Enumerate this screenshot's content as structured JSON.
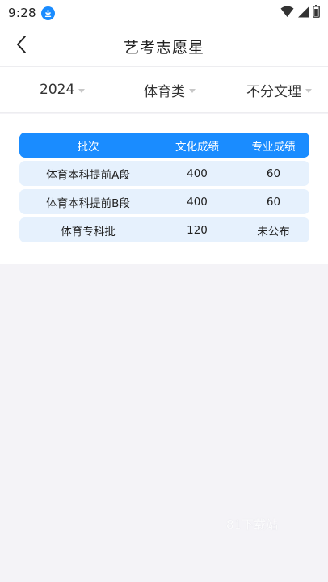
{
  "status_bar": {
    "time": "9:28"
  },
  "nav": {
    "title": "艺考志愿星"
  },
  "filters": {
    "year": "2024",
    "category": "体育类",
    "subject": "不分文理"
  },
  "table": {
    "headers": [
      "批次",
      "文化成绩",
      "专业成绩"
    ],
    "rows": [
      [
        "体育本科提前A段",
        "400",
        "60"
      ],
      [
        "体育本科提前B段",
        "400",
        "60"
      ],
      [
        "体育专科批",
        "120",
        "未公布"
      ]
    ]
  },
  "watermark": "81下载站",
  "colors": {
    "accent": "#1a8cff",
    "row_bg": "#e6f1fd",
    "page_bg": "#f4f3f7"
  },
  "icons": {
    "download_badge": "download-icon",
    "wifi": "wifi-icon",
    "signal": "signal-icon",
    "battery": "battery-icon",
    "back": "back-arrow-icon"
  }
}
